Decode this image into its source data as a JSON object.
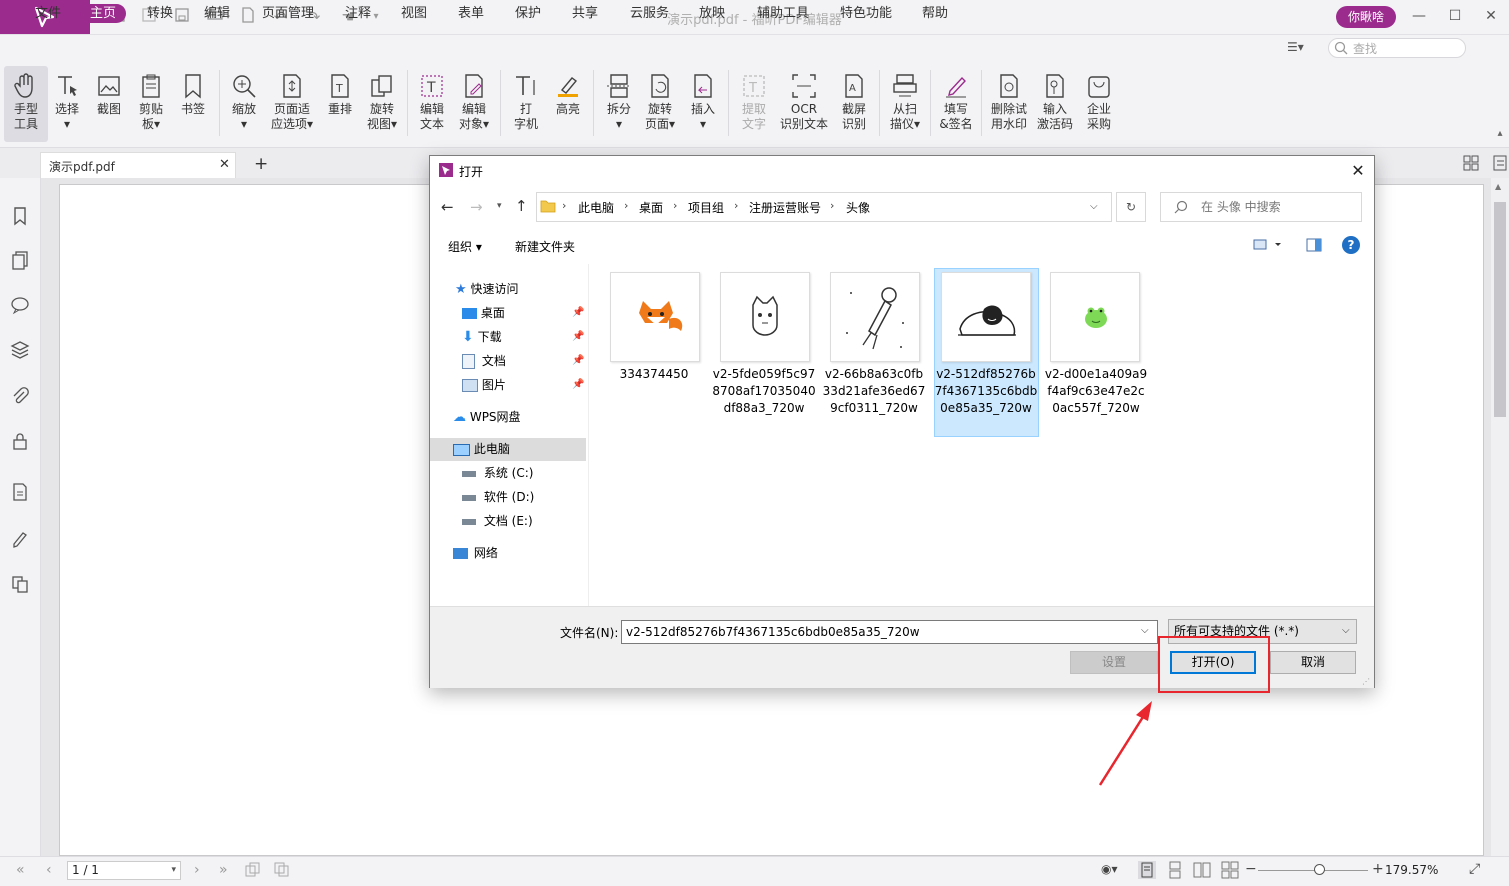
{
  "window": {
    "title": "演示pdf.pdf - 福昕PDF编辑器",
    "user_button": "你瞅啥"
  },
  "menu": {
    "items": [
      "文件",
      "主页",
      "转换",
      "编辑",
      "页面管理",
      "注释",
      "视图",
      "表单",
      "保护",
      "共享",
      "云服务",
      "放映",
      "辅助工具",
      "特色功能",
      "帮助"
    ],
    "active": "主页",
    "search_placeholder": "查找"
  },
  "ribbon": {
    "tools": [
      {
        "l1": "手型",
        "l2": "工具"
      },
      {
        "l1": "选择",
        "l2": "▾"
      },
      {
        "l1": "截图",
        "l2": ""
      },
      {
        "l1": "剪贴",
        "l2": "板▾"
      },
      {
        "l1": "书签",
        "l2": ""
      },
      {
        "l1": "缩放",
        "l2": "▾"
      },
      {
        "l1": "页面适",
        "l2": "应选项▾"
      },
      {
        "l1": "重排",
        "l2": ""
      },
      {
        "l1": "旋转",
        "l2": "视图▾"
      },
      {
        "l1": "编辑",
        "l2": "文本"
      },
      {
        "l1": "编辑",
        "l2": "对象▾"
      },
      {
        "l1": "打",
        "l2": "字机"
      },
      {
        "l1": "高亮",
        "l2": ""
      },
      {
        "l1": "拆分",
        "l2": "▾"
      },
      {
        "l1": "旋转",
        "l2": "页面▾"
      },
      {
        "l1": "插入",
        "l2": "▾"
      },
      {
        "l1": "提取",
        "l2": "文字"
      },
      {
        "l1": "OCR",
        "l2": "识别文本"
      },
      {
        "l1": "截屏",
        "l2": "识别"
      },
      {
        "l1": "从扫",
        "l2": "描仪▾"
      },
      {
        "l1": "填写",
        "l2": "&签名"
      },
      {
        "l1": "删除试",
        "l2": "用水印"
      },
      {
        "l1": "输入",
        "l2": "激活码"
      },
      {
        "l1": "企业",
        "l2": "采购"
      }
    ]
  },
  "tabs": {
    "doc_tab": "演示pdf.pdf",
    "add": "+"
  },
  "statusbar": {
    "page_indicator": "1 / 1",
    "zoom": "179.57%",
    "zoom_level": 0.55
  },
  "dialog": {
    "title": "打开",
    "breadcrumb": [
      "此电脑",
      "桌面",
      "项目组",
      "注册运营账号",
      "头像"
    ],
    "search_placeholder": "在 头像 中搜索",
    "toolbar": {
      "organize": "组织 ▾",
      "new_folder": "新建文件夹",
      "help": "?"
    },
    "nav": {
      "quick_access": "快速访问",
      "desktop": "桌面",
      "downloads": "下载",
      "documents": "文档",
      "pictures": "图片",
      "wps": "WPS网盘",
      "this_pc": "此电脑",
      "drive_c": "系统 (C:)",
      "drive_d": "软件 (D:)",
      "drive_e": "文档 (E:)",
      "network": "网络"
    },
    "files": [
      {
        "name": "334374450"
      },
      {
        "name": "v2-5fde059f5c978708af17035040df88a3_720w"
      },
      {
        "name": "v2-66b8a63c0fb33d21afe36ed679cf0311_720w"
      },
      {
        "name": "v2-512df85276b7f4367135c6bdb0e85a35_720w"
      },
      {
        "name": "v2-d00e1a409a9f4af9c63e47e2c0ac557f_720w"
      }
    ],
    "filename_label": "文件名(N):",
    "filename_value": "v2-512df85276b7f4367135c6bdb0e85a35_720w",
    "filetype": "所有可支持的文件 (*.*)",
    "settings_btn": "设置",
    "open_btn": "打开(O)",
    "cancel_btn": "取消"
  },
  "colors": {
    "brand": "#9c2b8e",
    "selection": "#cce8ff",
    "annotation_red": "#e8262e"
  }
}
